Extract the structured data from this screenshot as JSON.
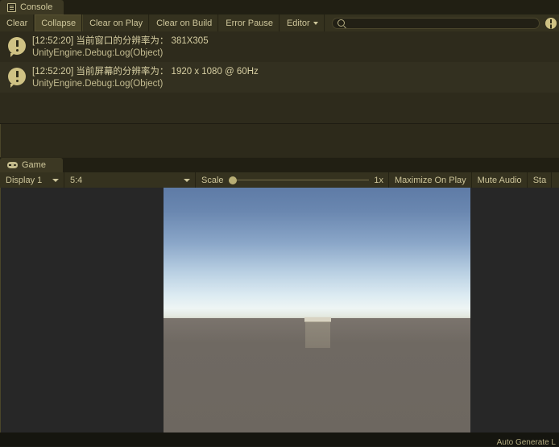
{
  "console": {
    "tab": {
      "label": "Console",
      "icon": "console-icon"
    },
    "toolbar": {
      "clear": "Clear",
      "collapse": "Collapse",
      "clear_on_play": "Clear on Play",
      "clear_on_build": "Clear on Build",
      "error_pause": "Error Pause",
      "editor": "Editor",
      "search_placeholder": "",
      "search_value": "",
      "search_icon": "search-icon",
      "notify_icon": "warning-icon"
    },
    "logs": [
      {
        "message": "[12:52:20] 当前窗口的分辨率为： 381X305",
        "stacktrace": "UnityEngine.Debug:Log(Object)",
        "icon": "log-info-icon"
      },
      {
        "message": "[12:52:20] 当前屏幕的分辨率为： 1920 x 1080 @ 60Hz",
        "stacktrace": "UnityEngine.Debug:Log(Object)",
        "icon": "log-info-icon"
      }
    ]
  },
  "game": {
    "tab": {
      "label": "Game",
      "icon": "gamepad-icon"
    },
    "toolbar": {
      "display": "Display 1",
      "aspect": "5:4",
      "scale_label": "Scale",
      "scale_value": "1x",
      "maximize_on_play": "Maximize On Play",
      "mute_audio": "Mute Audio",
      "stats": "Sta"
    },
    "view": {
      "sky_color": "#5e7ba6",
      "horizon_color": "#eef5f4",
      "ground_color": "#6d6760",
      "cube_color": "#837c70",
      "cube_top_color": "#d8d3c2"
    }
  },
  "status": {
    "text": "Auto Generate L"
  }
}
